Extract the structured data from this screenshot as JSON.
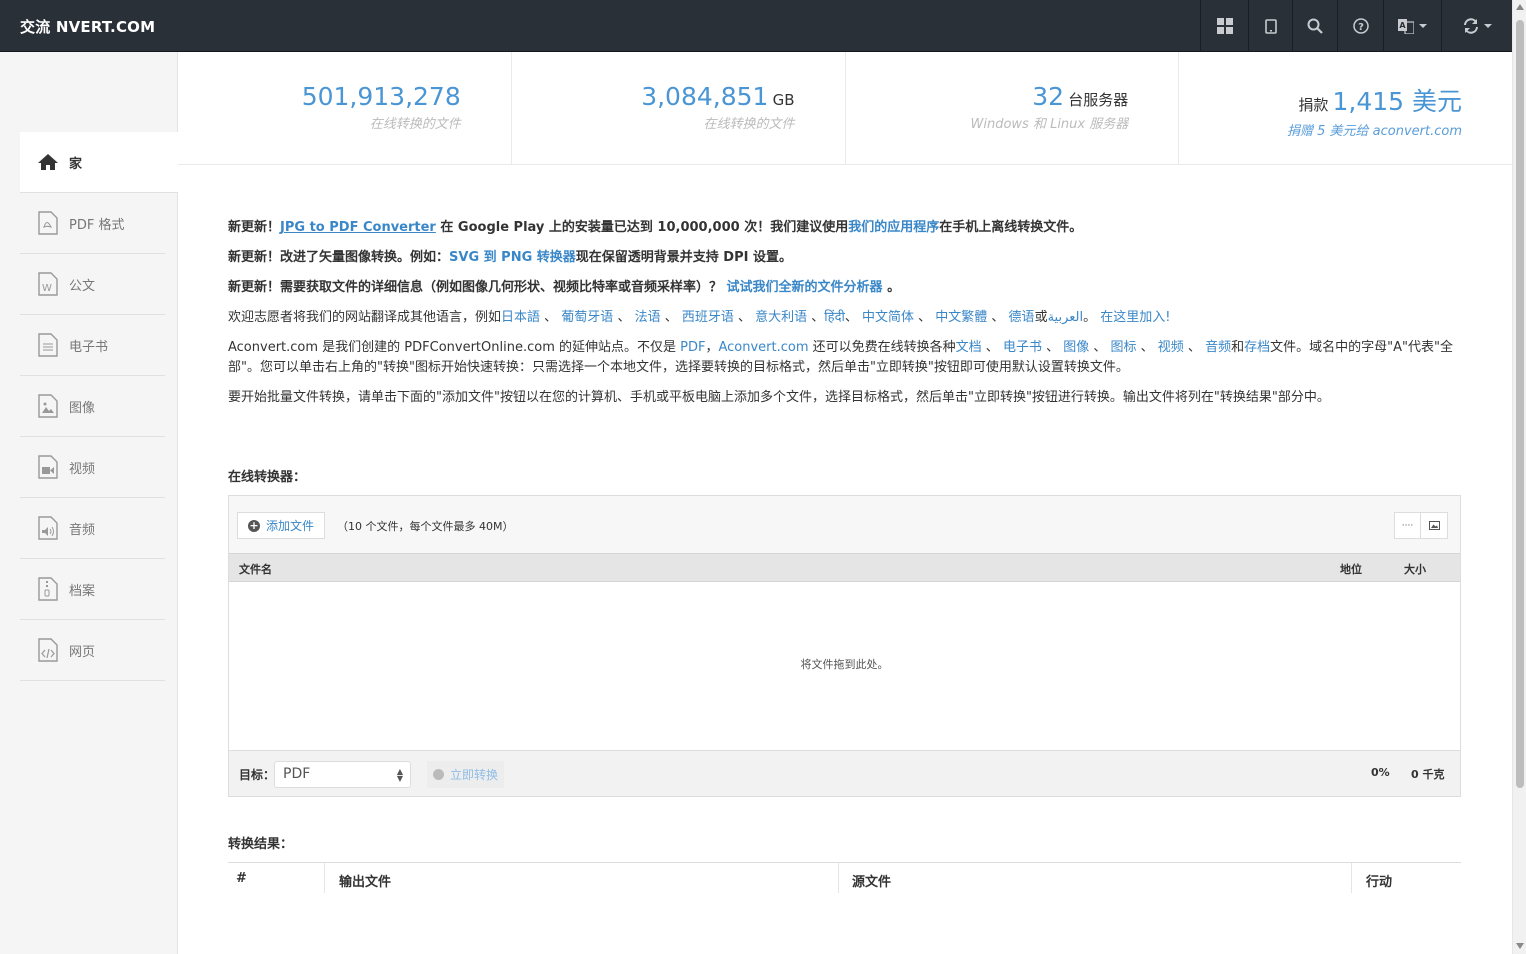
{
  "brand": "交流 NVERT.COM",
  "nav": {
    "icons": [
      "grid-icon",
      "tablet-icon",
      "search-icon",
      "help-icon",
      "language-icon",
      "refresh-icon"
    ]
  },
  "sidebar": {
    "items": [
      {
        "label": "家",
        "icon": "home-icon"
      },
      {
        "label": "PDF 格式",
        "icon": "pdf-file-icon"
      },
      {
        "label": "公文",
        "icon": "word-file-icon"
      },
      {
        "label": "电子书",
        "icon": "ebook-file-icon"
      },
      {
        "label": "图像",
        "icon": "image-file-icon"
      },
      {
        "label": "视频",
        "icon": "video-file-icon"
      },
      {
        "label": "音频",
        "icon": "audio-file-icon"
      },
      {
        "label": "档案",
        "icon": "archive-file-icon"
      },
      {
        "label": "网页",
        "icon": "webpage-file-icon"
      }
    ]
  },
  "stats": [
    {
      "value": "501,913,278",
      "unit": "",
      "prefix": "",
      "sub": "在线转换的文件"
    },
    {
      "value": "3,084,851",
      "unit": "GB",
      "prefix": "",
      "sub": "在线转换的文件"
    },
    {
      "value": "32",
      "unit": "台服务器",
      "prefix": "",
      "sub": "Windows 和 Linux 服务器"
    },
    {
      "value": "1,415 美元",
      "unit": "",
      "prefix": "捐款",
      "sub": "捐赠 5 美元给 aconvert.com"
    }
  ],
  "news": {
    "n1": {
      "a": "新更新！",
      "link": "JPG to PDF Converter",
      "b": " 在 Google Play 上的安装量已达到 10,000,000 次！我们建议使用",
      "link2": "我们的应用程序",
      "c": "在手机上离线转换文件。"
    },
    "n2": {
      "a": "新更新！改进了矢量图像转换。例如：",
      "link": "SVG 到 PNG 转换器",
      "b": "现在保留透明背景并支持 DPI 设置。"
    },
    "n3": {
      "a": "新更新！需要获取文件的详细信息（例如图像几何形状、视频比特率或音频采样率）？ ",
      "link": "试试我们全新的文件分析器",
      "b": " 。"
    }
  },
  "volunteer": {
    "text": "欢迎志愿者将我们的网站翻译成其他语言，例如",
    "langs": [
      "日本語",
      "葡萄牙语",
      "法语",
      "西班牙语",
      "意大利语",
      "हिंदी",
      "中文简体",
      "中文繁體",
      "德语"
    ],
    "or": "或",
    "arabic": "العربية",
    "join": "在这里加入!"
  },
  "intro": {
    "a": "Aconvert.com 是我们创建的 PDFConvertOnline.com 的延伸站点。不仅是 ",
    "pdf": "PDF",
    "comma": "，",
    "site": "Aconvert.com",
    "b": " 还可以免费在线转换各种",
    "doc": "文档",
    "ebook": "电子书",
    "image": "图像",
    "iconlink": "图标",
    "video": "视频",
    "audio": "音频",
    "and": "和",
    "archive": "存档",
    "c": "文件。域名中的字母\"A\"代表\"全部\"。您可以单击右上角的\"转换\"图标开始快速转换：只需选择一个本地文件，选择要转换的目标格式，然后单击\"立即转换\"按钮即可使用默认设置转换文件。"
  },
  "batch": "要开始批量文件转换，请单击下面的\"添加文件\"按钮以在您的计算机、手机或平板电脑上添加多个文件，选择目标格式，然后单击\"立即转换\"按钮进行转换。输出文件将列在\"转换结果\"部分中。",
  "converter": {
    "title": "在线转换器：",
    "add_button": "添加文件",
    "limit": "（10 个文件，每个文件最多 40M）",
    "columns": {
      "filename": "文件名",
      "status": "地位",
      "size": "大小"
    },
    "drop_text": "将文件拖到此处。",
    "target_label": "目标：",
    "target_value": "PDF",
    "convert_button": "立即转换",
    "progress": "0%",
    "total_size": "0 千克"
  },
  "results": {
    "title": "转换结果：",
    "columns": {
      "num": "#",
      "output": "输出文件",
      "source": "源文件",
      "action": "行动"
    }
  }
}
